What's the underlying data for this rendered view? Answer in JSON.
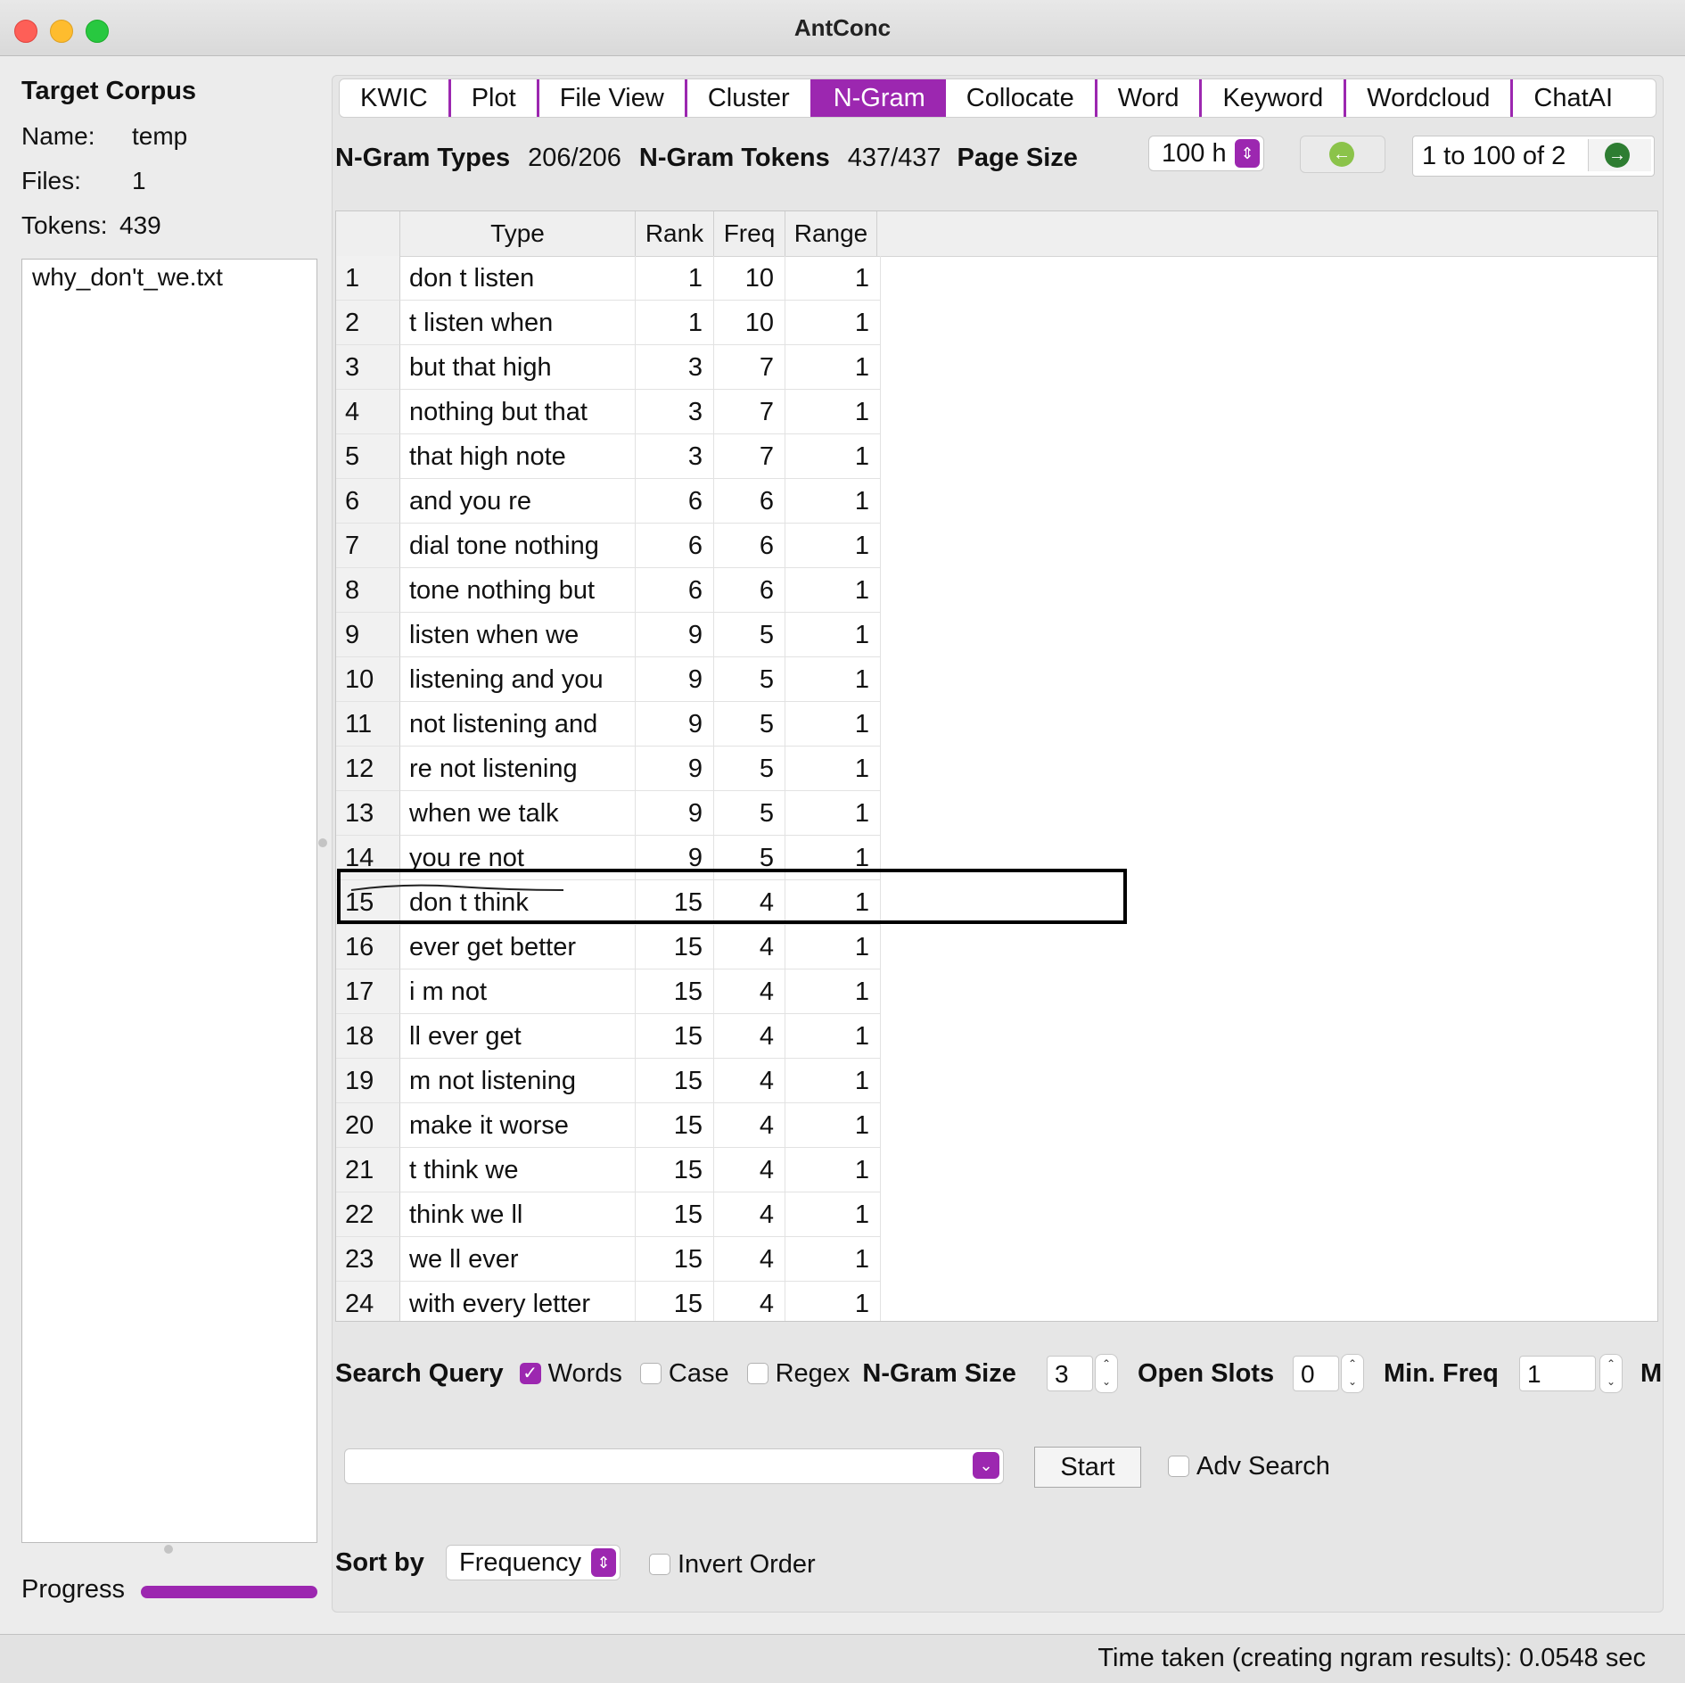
{
  "window": {
    "title": "AntConc"
  },
  "corpus": {
    "heading": "Target Corpus",
    "name_label": "Name:",
    "name_value": "temp",
    "files_label": "Files:",
    "files_value": "1",
    "tokens_label": "Tokens:",
    "tokens_value": "439",
    "files": [
      "why_don't_we.txt"
    ],
    "progress_label": "Progress"
  },
  "tabs": [
    "KWIC",
    "Plot",
    "File View",
    "Cluster",
    "N-Gram",
    "Collocate",
    "Word",
    "Keyword",
    "Wordcloud",
    "ChatAI"
  ],
  "active_tab": "N-Gram",
  "stats": {
    "types_label": "N-Gram Types",
    "types_value": "206/206",
    "tokens_label": "N-Gram Tokens",
    "tokens_value": "437/437",
    "page_size_label": "Page Size",
    "page_size_value": "100 h",
    "page_range": "1 to 100 of 2"
  },
  "table": {
    "columns": [
      "Type",
      "Rank",
      "Freq",
      "Range"
    ],
    "rows": [
      {
        "n": "1",
        "type": "don t listen",
        "rank": "1",
        "freq": "10",
        "range": "1"
      },
      {
        "n": "2",
        "type": "t listen when",
        "rank": "1",
        "freq": "10",
        "range": "1"
      },
      {
        "n": "3",
        "type": "but that high",
        "rank": "3",
        "freq": "7",
        "range": "1"
      },
      {
        "n": "4",
        "type": "nothing but that",
        "rank": "3",
        "freq": "7",
        "range": "1"
      },
      {
        "n": "5",
        "type": "that high note",
        "rank": "3",
        "freq": "7",
        "range": "1"
      },
      {
        "n": "6",
        "type": "and you re",
        "rank": "6",
        "freq": "6",
        "range": "1"
      },
      {
        "n": "7",
        "type": "dial tone nothing",
        "rank": "6",
        "freq": "6",
        "range": "1"
      },
      {
        "n": "8",
        "type": "tone nothing but",
        "rank": "6",
        "freq": "6",
        "range": "1"
      },
      {
        "n": "9",
        "type": "listen when we",
        "rank": "9",
        "freq": "5",
        "range": "1"
      },
      {
        "n": "10",
        "type": "listening and you",
        "rank": "9",
        "freq": "5",
        "range": "1"
      },
      {
        "n": "11",
        "type": "not listening and",
        "rank": "9",
        "freq": "5",
        "range": "1"
      },
      {
        "n": "12",
        "type": "re not listening",
        "rank": "9",
        "freq": "5",
        "range": "1"
      },
      {
        "n": "13",
        "type": "when we talk",
        "rank": "9",
        "freq": "5",
        "range": "1"
      },
      {
        "n": "14",
        "type": "you re not",
        "rank": "9",
        "freq": "5",
        "range": "1"
      },
      {
        "n": "15",
        "type": "don t think",
        "rank": "15",
        "freq": "4",
        "range": "1"
      },
      {
        "n": "16",
        "type": "ever get better",
        "rank": "15",
        "freq": "4",
        "range": "1"
      },
      {
        "n": "17",
        "type": "i m not",
        "rank": "15",
        "freq": "4",
        "range": "1"
      },
      {
        "n": "18",
        "type": "ll ever get",
        "rank": "15",
        "freq": "4",
        "range": "1"
      },
      {
        "n": "19",
        "type": "m not listening",
        "rank": "15",
        "freq": "4",
        "range": "1"
      },
      {
        "n": "20",
        "type": "make it worse",
        "rank": "15",
        "freq": "4",
        "range": "1"
      },
      {
        "n": "21",
        "type": "t think we",
        "rank": "15",
        "freq": "4",
        "range": "1"
      },
      {
        "n": "22",
        "type": "think we ll",
        "rank": "15",
        "freq": "4",
        "range": "1"
      },
      {
        "n": "23",
        "type": "we ll ever",
        "rank": "15",
        "freq": "4",
        "range": "1"
      },
      {
        "n": "24",
        "type": "with every letter",
        "rank": "15",
        "freq": "4",
        "range": "1"
      }
    ]
  },
  "search": {
    "label": "Search Query",
    "words_label": "Words",
    "words_checked": true,
    "case_label": "Case",
    "case_checked": false,
    "regex_label": "Regex",
    "regex_checked": false,
    "ngram_size_label": "N-Gram Size",
    "ngram_size_value": "3",
    "open_slots_label": "Open Slots",
    "open_slots_value": "0",
    "min_freq_label": "Min. Freq",
    "min_freq_value": "1",
    "trailing_label": "M",
    "query_value": "",
    "start_label": "Start",
    "adv_search_label": "Adv Search"
  },
  "sort": {
    "label": "Sort by",
    "value": "Frequency",
    "invert_label": "Invert Order",
    "invert_checked": false
  },
  "status": {
    "text": "Time taken (creating ngram results):  0.0548 sec"
  },
  "colors": {
    "accent": "#9c27b0",
    "nav_prev": "#8bc34a",
    "nav_next": "#2e7d32"
  }
}
